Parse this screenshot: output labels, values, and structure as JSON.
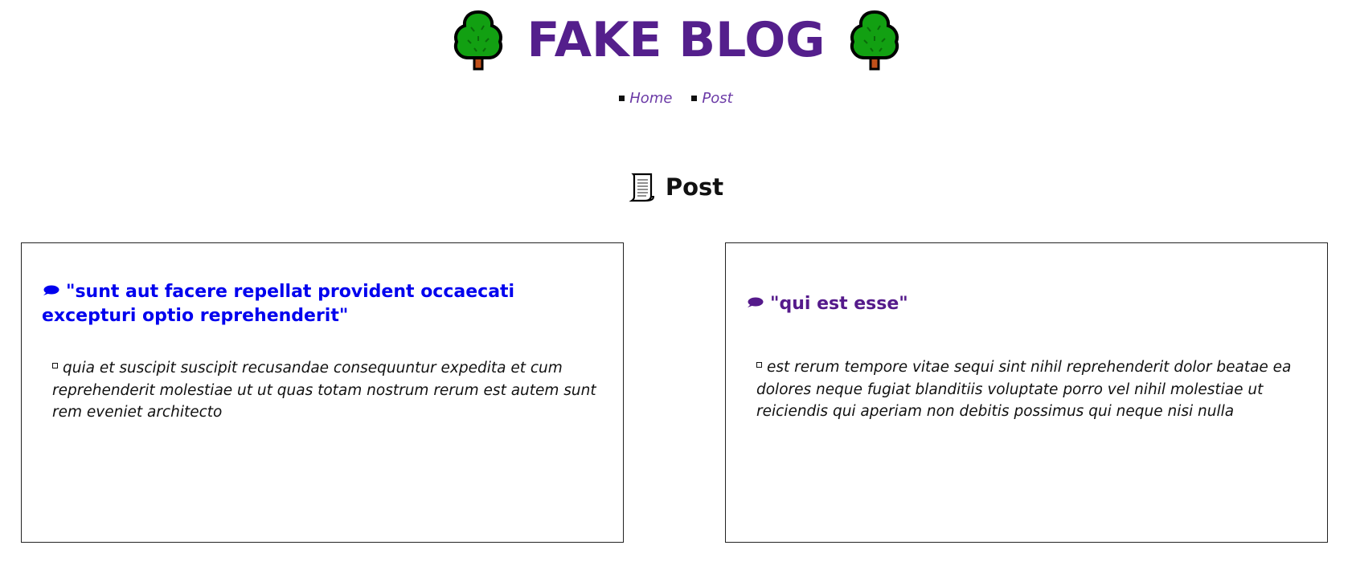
{
  "header": {
    "title": "FAKE BLOG",
    "left_icon": "tree-icon",
    "right_icon": "tree-icon",
    "title_color": "#541f8c"
  },
  "nav": {
    "items": [
      {
        "label": "Home"
      },
      {
        "label": "Post"
      }
    ]
  },
  "section": {
    "icon": "scroll-icon",
    "title": "Post"
  },
  "posts": [
    {
      "icon": "speech-bubble-icon",
      "title": "\"sunt aut facere repellat provident occaecati excepturi optio reprehenderit\"",
      "link_state": "unvisited",
      "body": "quia et suscipit suscipit recusandae consequuntur expedita et cum reprehenderit molestiae ut ut quas totam nostrum rerum est autem sunt rem eveniet architecto"
    },
    {
      "icon": "speech-bubble-icon",
      "title": "\"qui est esse\"",
      "link_state": "visited",
      "body": "est rerum tempore vitae sequi sint nihil reprehenderit dolor beatae ea dolores neque fugiat blanditiis voluptate porro vel nihil molestiae ut reiciendis qui aperiam non debitis possimus qui neque nisi nulla"
    }
  ],
  "colors": {
    "unvisited_link": "#0000ee",
    "visited_link": "#551a8b",
    "nav_link": "#6b3aa6",
    "tree_green": "#12a012",
    "trunk": "#c0501a"
  }
}
